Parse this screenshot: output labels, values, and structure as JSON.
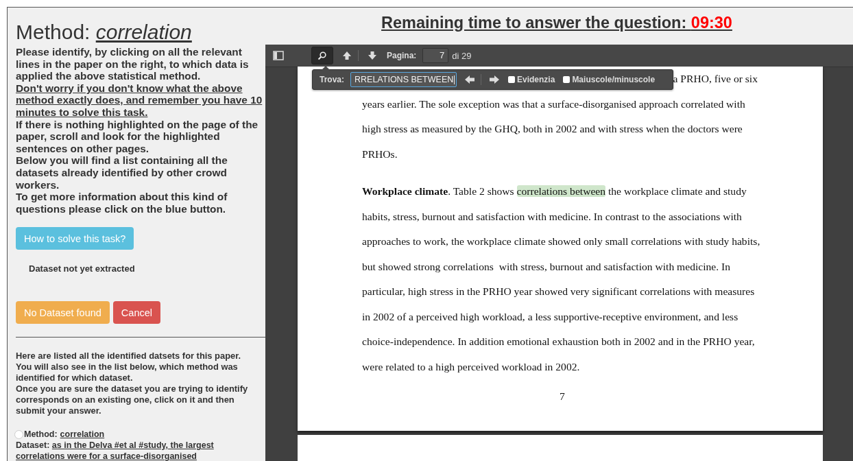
{
  "method_title": {
    "label": "Method:",
    "value": "correlation"
  },
  "instructions": [
    {
      "kind": "plain",
      "text": "Please identify, by clicking on all the relevant lines in the paper on the right, to which data is applied the above statistical method."
    },
    {
      "kind": "underlined",
      "text": "Don't worry if you don't know what the above method exactly does, and remember you have 10 minutes to solve this task."
    },
    {
      "kind": "plain",
      "text": "If there is nothing highlighted on the page of the paper, scroll and look for the highlighted sentences on other pages."
    },
    {
      "kind": "plain",
      "text": "Below you will find a list containing all the datasets already identified by other crowd workers."
    },
    {
      "kind": "plain",
      "text": "To get more information about this kind of questions please click on the blue button."
    }
  ],
  "help_button": "How to solve this task?",
  "dataset_status": "Dataset not yet extracted",
  "action_buttons": [
    {
      "kind": "warning",
      "label": "No Dataset found"
    },
    {
      "kind": "danger",
      "label": "Cancel"
    }
  ],
  "list_intro": [
    "Here are listed all the identified datsets for this paper. You will also see in the list below, which method was identified for which dataset.",
    "Once you are sure the dataset you are trying to identify corresponds on an existing one, click on it and then submit your answer."
  ],
  "datasets": [
    {
      "selected": false,
      "method_label": "Method:",
      "method": "correlation",
      "dataset_label": "Dataset:",
      "dataset": "as in the Delva #et al #study, the largest correlations were for a surface-disorganised"
    }
  ],
  "timer": {
    "label": "Remaining time to answer the question:",
    "time": "09:30"
  },
  "viewer": {
    "search_open": true,
    "page_label": "Pagina:",
    "page": "7",
    "page_total": "di 29",
    "find_bar": {
      "label": "Trova:",
      "value": "RRELATIONS BETWEEN",
      "options": [
        {
          "label": "Evidenzia",
          "checked": false
        },
        {
          "label": "Maiuscole/minuscole",
          "checked": false
        }
      ]
    },
    "paper": {
      "paragraphs": [
        {
          "lines": [
            [
              {
                "kind": "partial",
                "text": "a PRHO, five or six"
              }
            ],
            [
              {
                "kind": "plain",
                "text": "years earlier. The sole exception was that a surface-disorganised approach correlated with"
              }
            ],
            [
              {
                "kind": "plain",
                "text": "high stress as measured by the GHQ, both in 2002 and with stress when the doctors were"
              }
            ],
            [
              {
                "kind": "plain",
                "text": "PRHOs."
              }
            ]
          ]
        },
        {
          "lines": [
            [
              {
                "kind": "bold",
                "text": "Workplace climate"
              },
              {
                "kind": "plain",
                "text": ". Table 2 shows "
              },
              {
                "kind": "highlight",
                "text": "correlations between"
              },
              {
                "kind": "plain",
                "text": " the workplace climate and study"
              }
            ],
            [
              {
                "kind": "plain",
                "text": "habits, stress, burnout and satisfaction with medicine. In contrast to the associations with"
              }
            ],
            [
              {
                "kind": "plain",
                "text": "approaches to work, the workplace climate showed only small correlations with study habits,"
              }
            ],
            [
              {
                "kind": "plain",
                "text": "but showed strong correlations  with stress, burnout and satisfaction with medicine. In"
              }
            ],
            [
              {
                "kind": "plain",
                "text": "particular, high stress in the PRHO year showed very significant correlations with measures"
              }
            ],
            [
              {
                "kind": "plain",
                "text": "in 2002 of a perceived high workload, a less supportive-receptive environment, and less"
              }
            ],
            [
              {
                "kind": "plain",
                "text": "choice-independence. In addition emotional exhaustion both in 2002 and in the PRHO year,"
              }
            ],
            [
              {
                "kind": "plain",
                "text": "were related to a high perceived workload in 2002."
              }
            ]
          ]
        }
      ],
      "page_number": "7"
    }
  }
}
